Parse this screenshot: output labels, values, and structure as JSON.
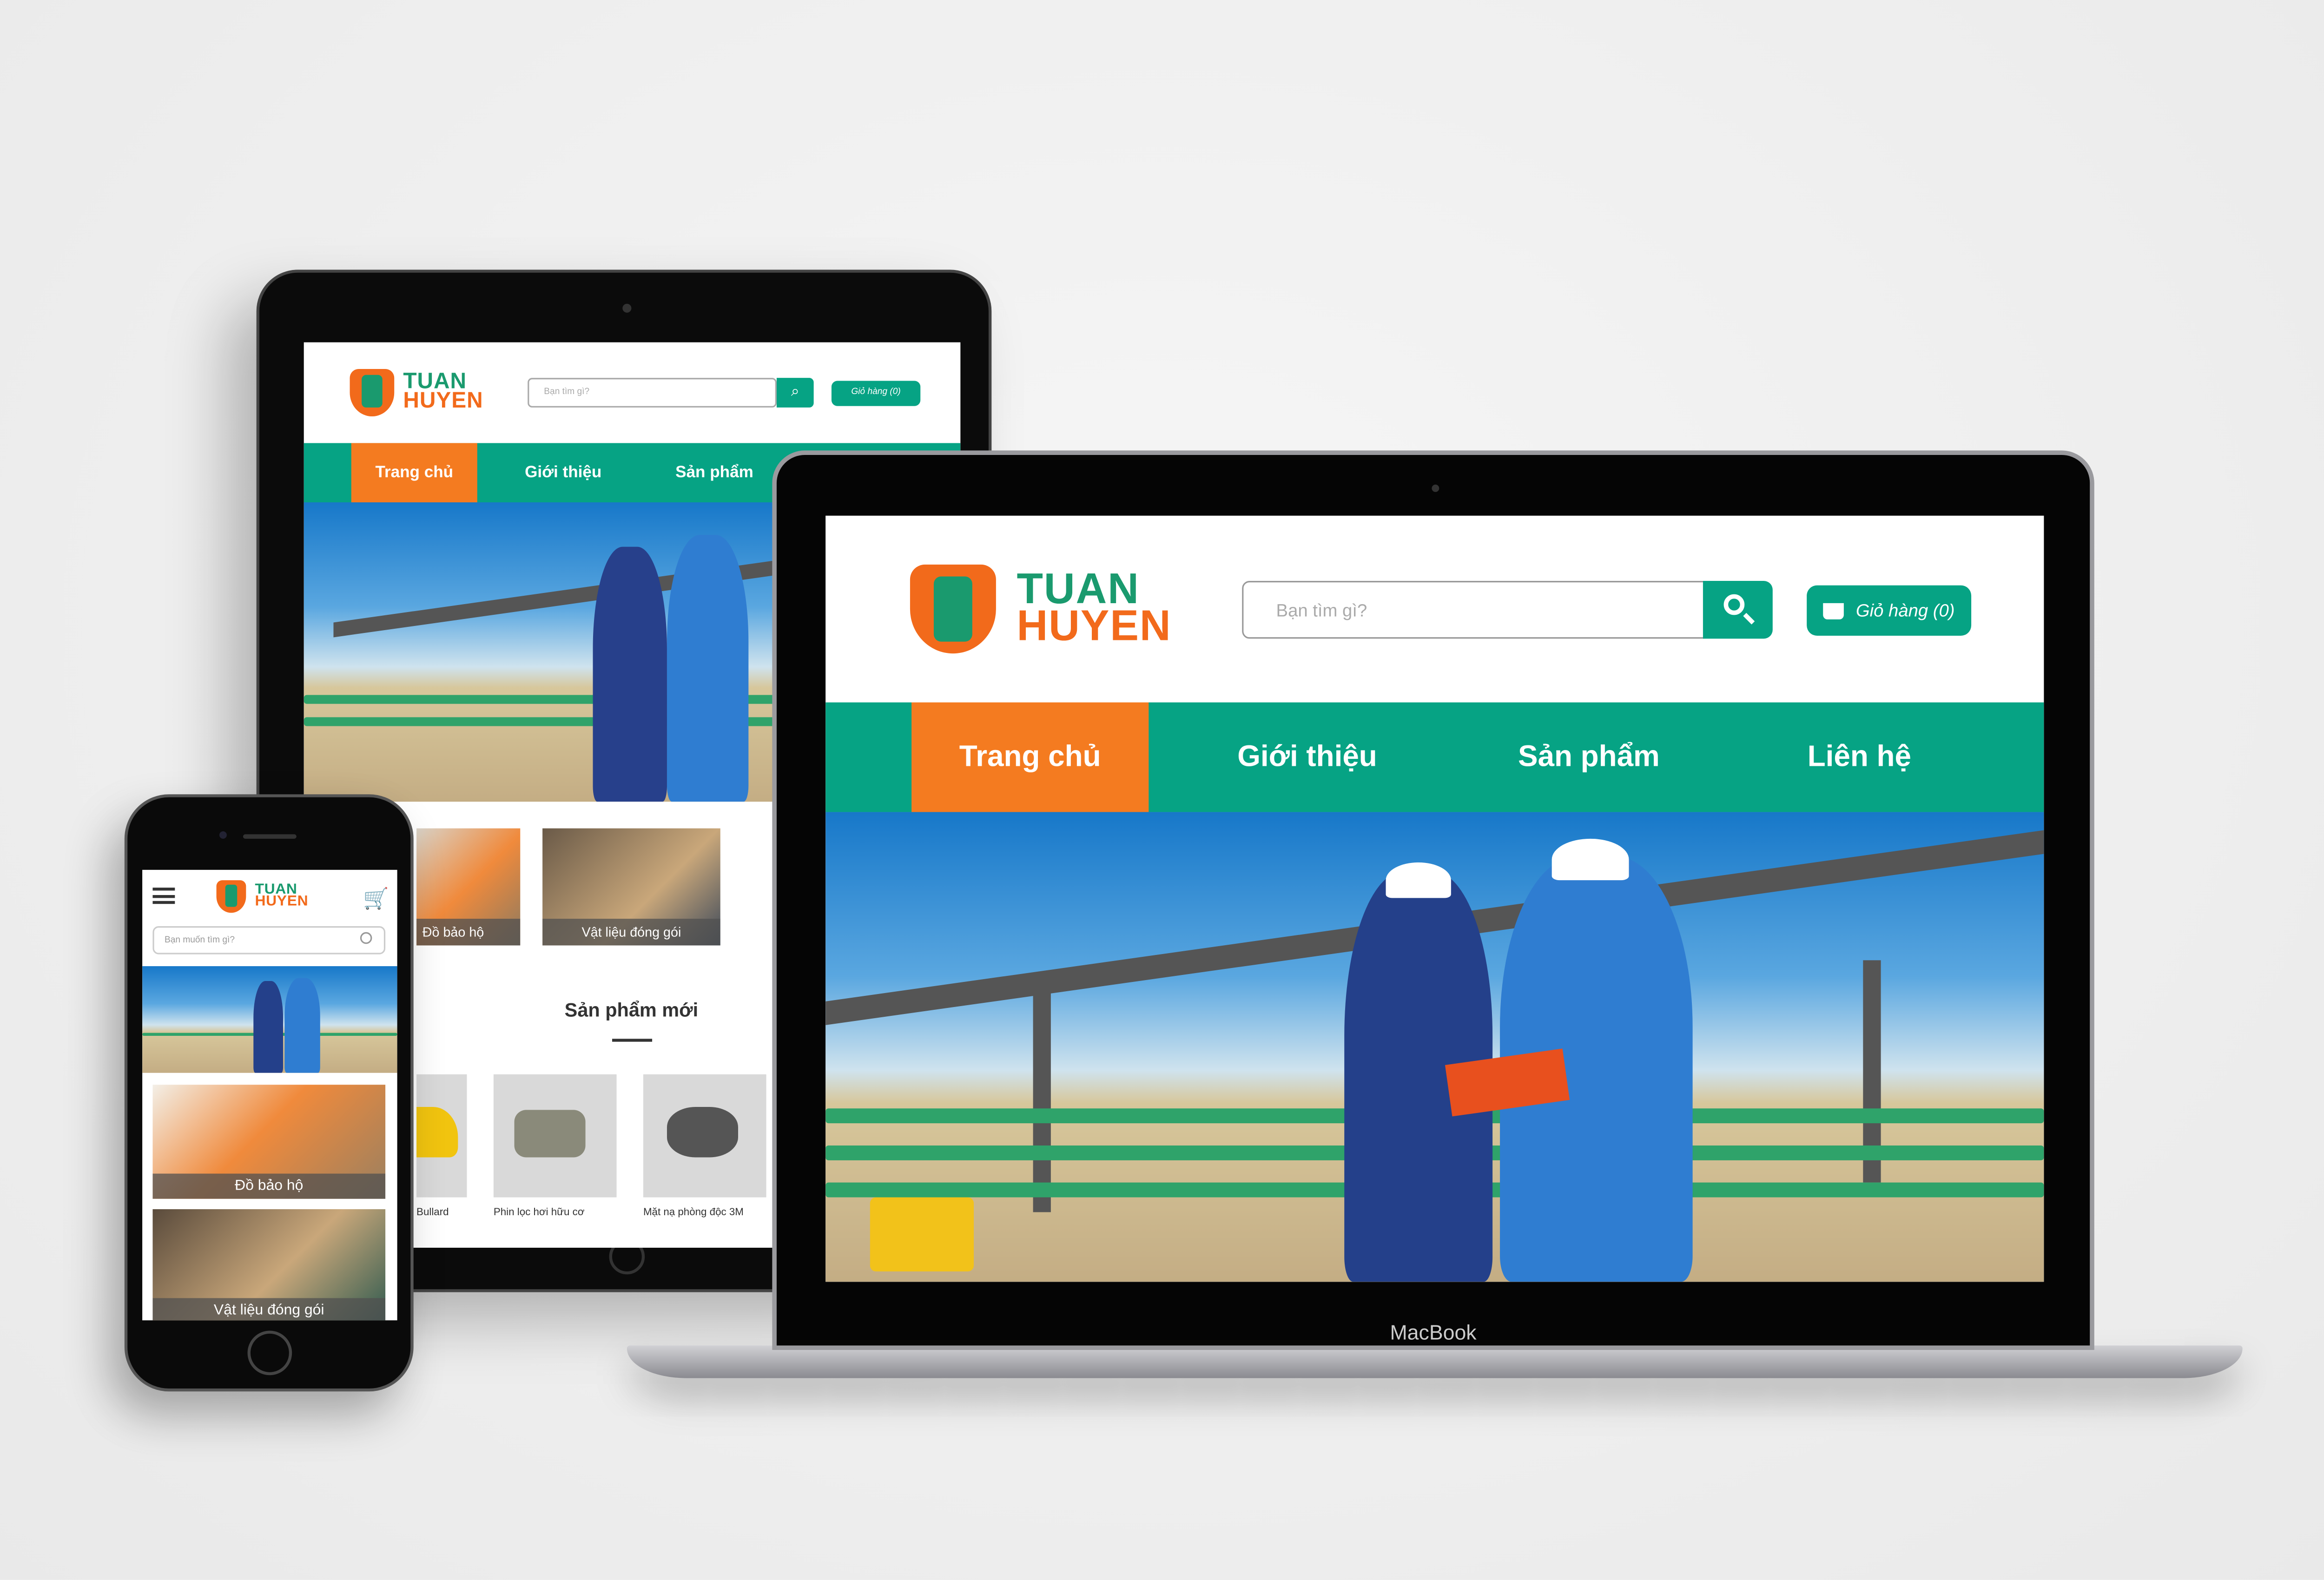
{
  "brand": {
    "line1": "TUAN",
    "line2": "HUYEN"
  },
  "search": {
    "placeholder_desktop": "Bạn tìm gì?",
    "placeholder_mobile": "Bạn muốn tìm gì?"
  },
  "cart": {
    "label": "Giỏ hàng (0)"
  },
  "nav": [
    "Trang chủ",
    "Giới thiệu",
    "Sản phẩm",
    "Liên hệ"
  ],
  "categories": [
    "Đồ bảo hộ",
    "Vật liệu đóng gói"
  ],
  "section_title": "Sản phẩm mới",
  "products": [
    "Bullard",
    "Phin lọc hơi hữu cơ",
    "Mặt nạ phòng độc 3M"
  ],
  "device_label": "MacBook",
  "colors": {
    "green": "#06a384",
    "orange": "#f47b20"
  }
}
